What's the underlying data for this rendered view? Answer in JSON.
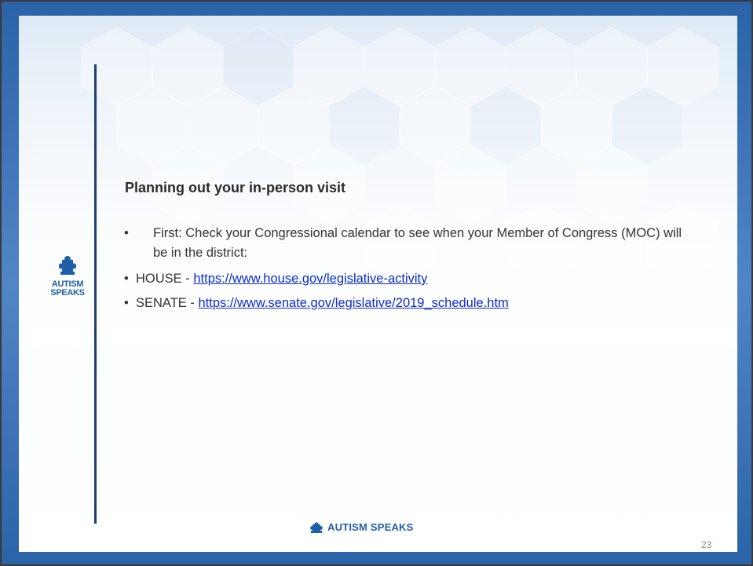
{
  "slide": {
    "title": "Planning out your in-person visit",
    "bullets": {
      "first": {
        "bullet_glyph": "•",
        "text": "First: Check your Congressional calendar to see when your Member of Congress (MOC) will be in the district:"
      },
      "house": {
        "bullet_glyph": "•",
        "prefix": "HOUSE - ",
        "link_text": "https://www.house.gov/legislative-activity"
      },
      "senate": {
        "bullet_glyph": "•",
        "prefix": "SENATE - ",
        "link_text": "https://www.senate.gov/legislative/2019_schedule.htm"
      }
    },
    "page_number": "23"
  },
  "branding": {
    "side_logo_line1": "AUTISM",
    "side_logo_line2": "SPEAKS",
    "side_logo_icon": "puzzle-piece-icon",
    "footer_logo_text": "AUTISM SPEAKS",
    "footer_logo_icon": "puzzle-piece-icon"
  },
  "colors": {
    "brand_blue": "#1f5ea8",
    "link_blue": "#0b2ccf",
    "rule_navy": "#1f3f73",
    "frame_blue": "#2b63a8"
  }
}
